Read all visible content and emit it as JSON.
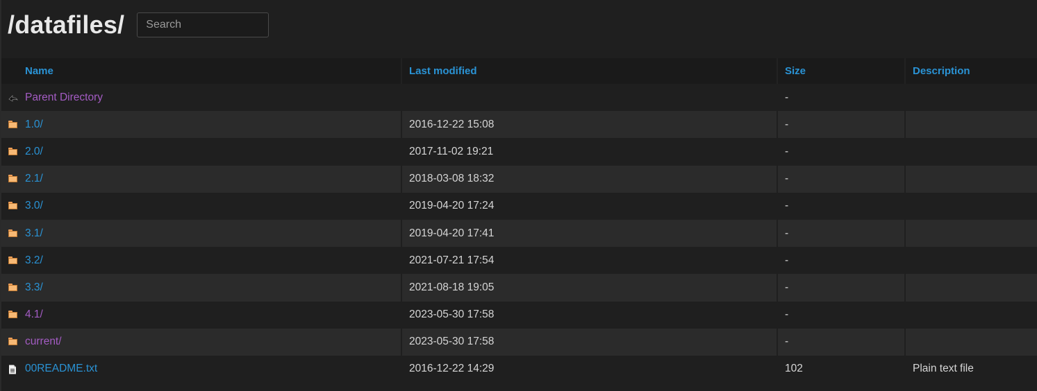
{
  "header": {
    "title": "/datafiles/",
    "search_placeholder": "Search"
  },
  "columns": {
    "name": "Name",
    "last_modified": "Last modified",
    "size": "Size",
    "description": "Description"
  },
  "rows": [
    {
      "icon": "back-icon",
      "name": "Parent Directory",
      "modified": "",
      "size": "-",
      "description": "",
      "visited": true
    },
    {
      "icon": "folder-icon",
      "name": "1.0/",
      "modified": "2016-12-22 15:08",
      "size": "-",
      "description": "",
      "visited": false
    },
    {
      "icon": "folder-icon",
      "name": "2.0/",
      "modified": "2017-11-02 19:21",
      "size": "-",
      "description": "",
      "visited": false
    },
    {
      "icon": "folder-icon",
      "name": "2.1/",
      "modified": "2018-03-08 18:32",
      "size": "-",
      "description": "",
      "visited": false
    },
    {
      "icon": "folder-icon",
      "name": "3.0/",
      "modified": "2019-04-20 17:24",
      "size": "-",
      "description": "",
      "visited": false
    },
    {
      "icon": "folder-icon",
      "name": "3.1/",
      "modified": "2019-04-20 17:41",
      "size": "-",
      "description": "",
      "visited": false
    },
    {
      "icon": "folder-icon",
      "name": "3.2/",
      "modified": "2021-07-21 17:54",
      "size": "-",
      "description": "",
      "visited": false
    },
    {
      "icon": "folder-icon",
      "name": "3.3/",
      "modified": "2021-08-18 19:05",
      "size": "-",
      "description": "",
      "visited": false
    },
    {
      "icon": "folder-icon",
      "name": "4.1/",
      "modified": "2023-05-30 17:58",
      "size": "-",
      "description": "",
      "visited": true
    },
    {
      "icon": "folder-icon",
      "name": "current/",
      "modified": "2023-05-30 17:58",
      "size": "-",
      "description": "",
      "visited": true
    },
    {
      "icon": "text-file-icon",
      "name": "00README.txt",
      "modified": "2016-12-22 14:29",
      "size": "102",
      "description": "Plain text file",
      "visited": false
    }
  ],
  "colors": {
    "background": "#1f1f1f",
    "row_alt": "#2b2b2b",
    "header_row": "#1a1a1a",
    "link": "#2a93d5",
    "link_visited": "#a45cc4",
    "text": "#d6d6d6",
    "folder": "#f7b975"
  }
}
